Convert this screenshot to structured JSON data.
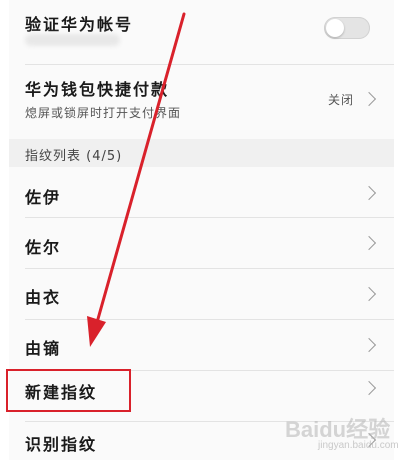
{
  "settings": {
    "verify_account_label": "验证华为帐号",
    "verify_account_enabled": false,
    "wallet_label": "华为钱包快捷付款",
    "wallet_sub": "熄屏或锁屏时打开支付界面",
    "wallet_value": "关闭"
  },
  "fingerprint_section": {
    "header": "指纹列表 (4/5)",
    "items": [
      {
        "label": "佐伊"
      },
      {
        "label": "佐尔"
      },
      {
        "label": "由衣"
      },
      {
        "label": "由镝"
      }
    ],
    "new_label": "新建指纹",
    "identify_label": "识别指纹"
  },
  "watermark": {
    "brand": "Baidu经验",
    "url": "jingyan.baidu.com"
  },
  "colors": {
    "highlight": "#d9212b",
    "arrow": "#d9212b"
  }
}
